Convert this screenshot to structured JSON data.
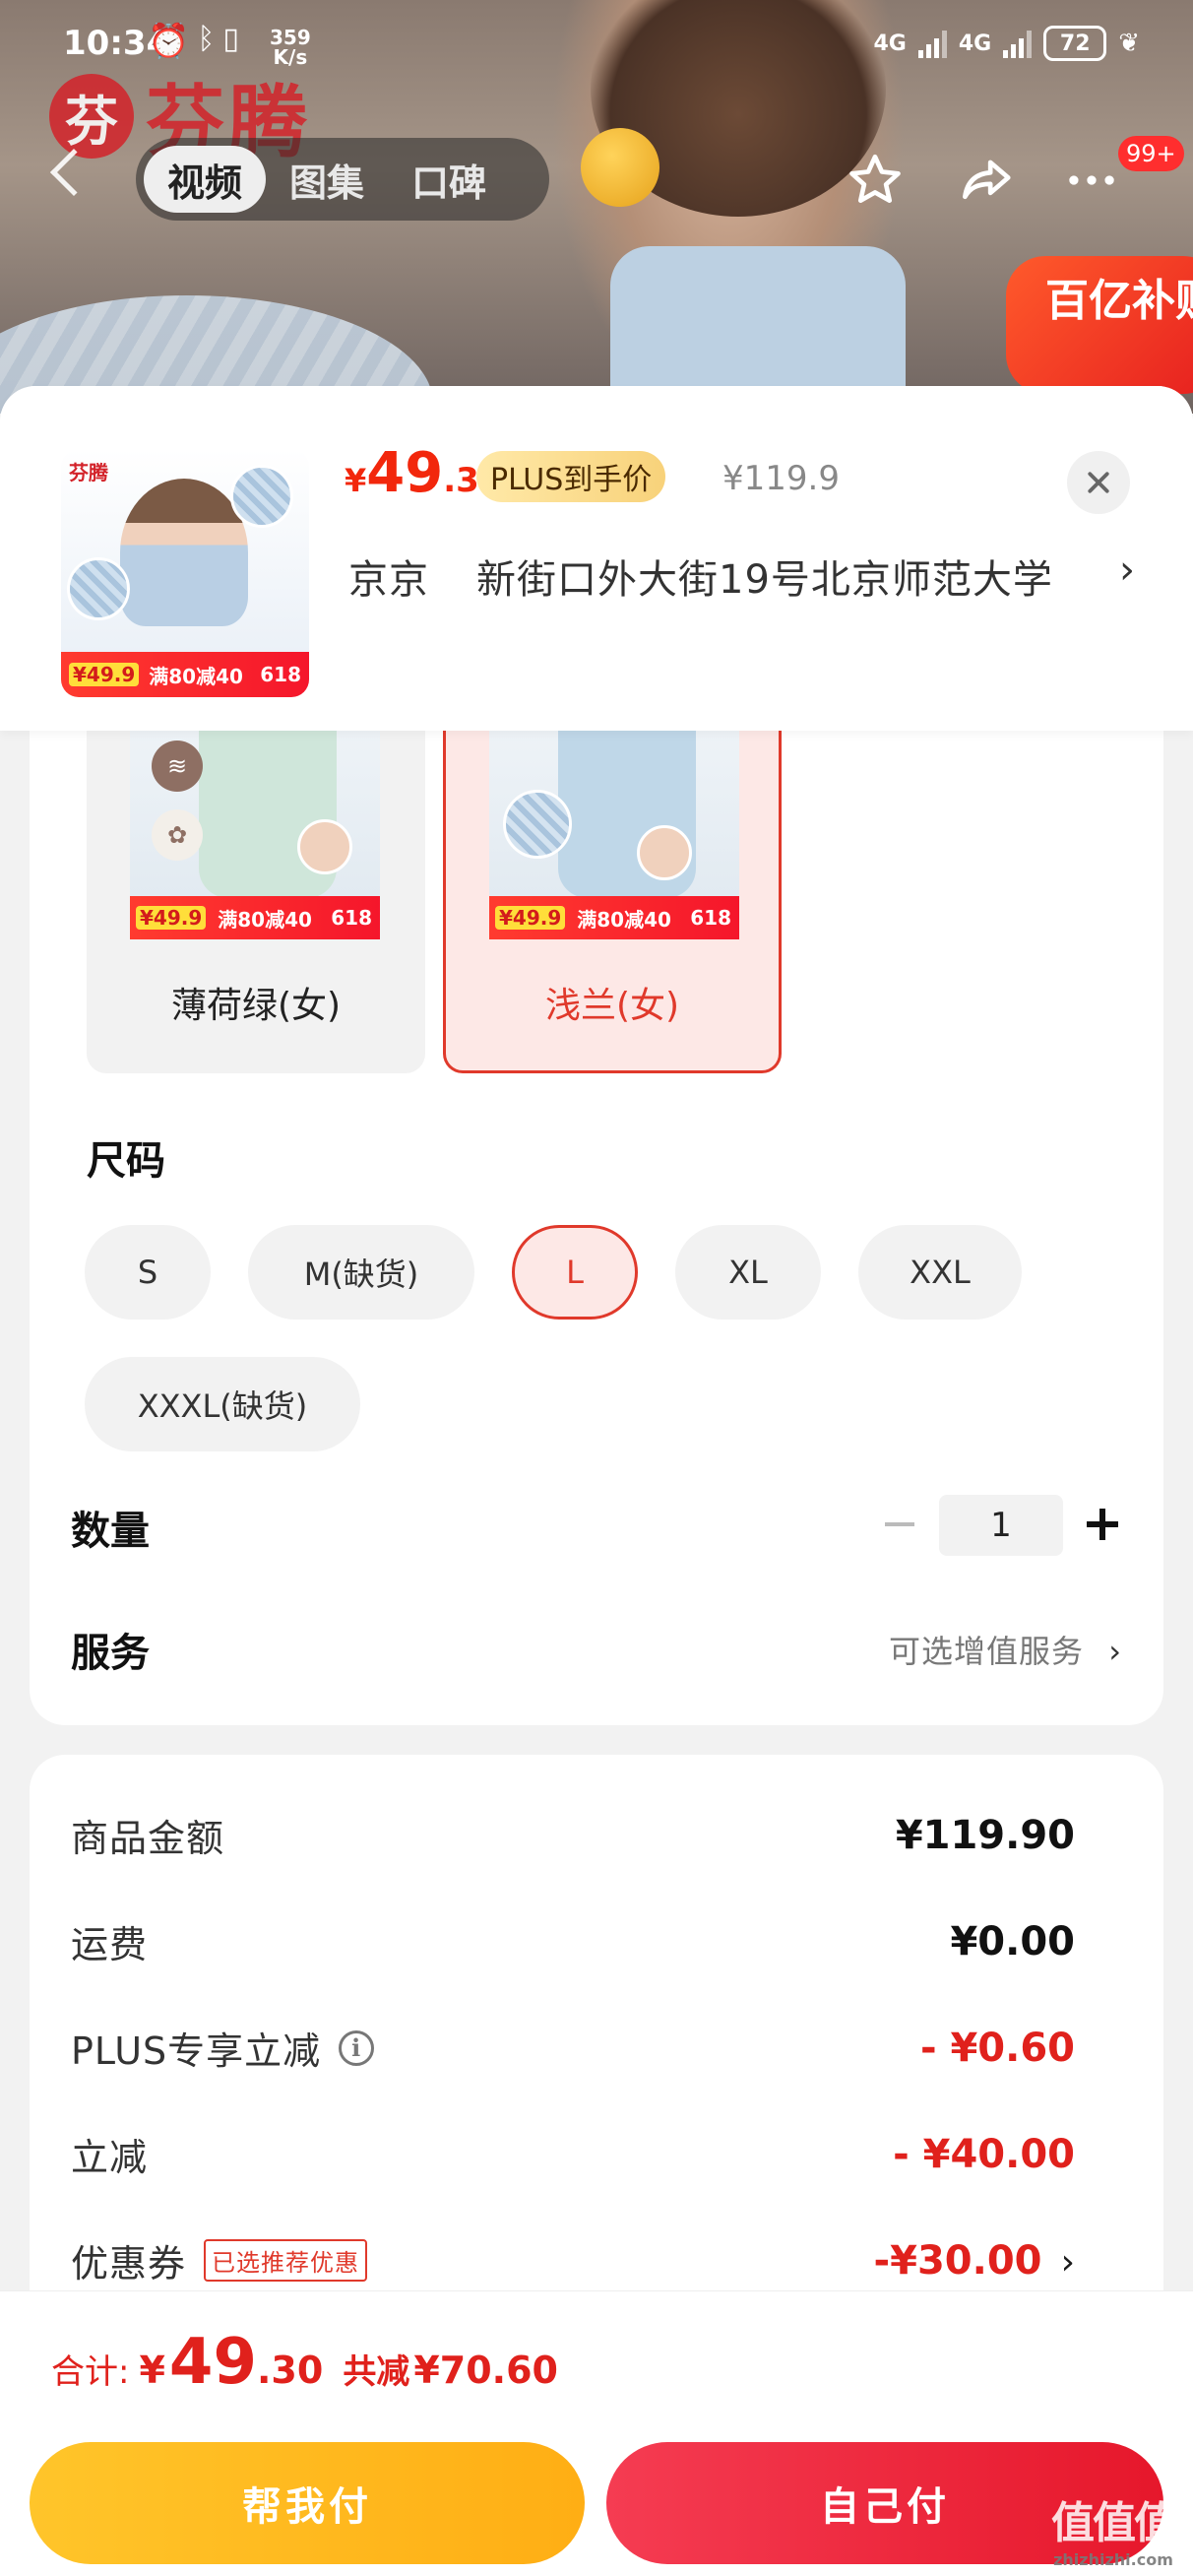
{
  "status_bar": {
    "time": "10:34",
    "speed_value": "359",
    "speed_unit": "K/s",
    "network_1": "4G",
    "network_2": "4G",
    "battery": "72"
  },
  "background": {
    "brand_mark": "芬",
    "brand_name": "芬腾",
    "subsidy_badge": "百亿补贴"
  },
  "nav": {
    "tabs": [
      {
        "label": "视频",
        "active": true
      },
      {
        "label": "图集",
        "active": false
      },
      {
        "label": "口碑",
        "active": false
      }
    ],
    "badge": "99+"
  },
  "product": {
    "thumb_brand": "芬腾",
    "thumb_promo_price": "¥49.9",
    "thumb_promo_text": "满80减40",
    "thumb_promo_tag": "618",
    "price_symbol": "¥",
    "price_int": "49",
    "price_dec": ".3",
    "plus_tag": "PLUS到手价",
    "original_price": "¥119.9",
    "address_city": "京京",
    "address_detail": "新街口外大街19号北京师范大学"
  },
  "colors": [
    {
      "label": "薄荷绿(女)",
      "selected": false,
      "promo_price": "¥49.9",
      "promo_text": "满80减40",
      "promo_tag": "618"
    },
    {
      "label": "浅兰(女)",
      "selected": true,
      "promo_price": "¥49.9",
      "promo_text": "满80减40",
      "promo_tag": "618"
    }
  ],
  "size": {
    "title": "尺码",
    "options": [
      {
        "label": "S",
        "selected": false
      },
      {
        "label": "M(缺货)",
        "selected": false
      },
      {
        "label": "L",
        "selected": true
      },
      {
        "label": "XL",
        "selected": false
      },
      {
        "label": "XXL",
        "selected": false
      },
      {
        "label": "XXXL(缺货)",
        "selected": false
      }
    ]
  },
  "quantity": {
    "title": "数量",
    "value": "1"
  },
  "service": {
    "title": "服务",
    "hint": "可选增值服务"
  },
  "costs": {
    "goods_label": "商品金额",
    "goods_value": "¥119.90",
    "shipping_label": "运费",
    "shipping_value": "¥0.00",
    "plus_label": "PLUS专享立减",
    "plus_value": "- ¥0.60",
    "instant_label": "立减",
    "instant_value": "- ¥40.00",
    "coupon_label": "优惠券",
    "coupon_tag": "已选推荐优惠",
    "coupon_value": "-¥30.00"
  },
  "total": {
    "label": "合计:",
    "symbol": "¥",
    "int": "49",
    "dec": ".30",
    "saved_label": "共减",
    "saved_value": "¥70.60"
  },
  "buttons": {
    "friend_pay": "帮我付",
    "self_pay": "自己付"
  },
  "watermark": {
    "big": "值值值",
    "small": "zhizhizhi.com"
  },
  "theme": {
    "accent": "#e0211c",
    "friend_button": "#ffb81c",
    "self_button": "#ee2a3f"
  }
}
